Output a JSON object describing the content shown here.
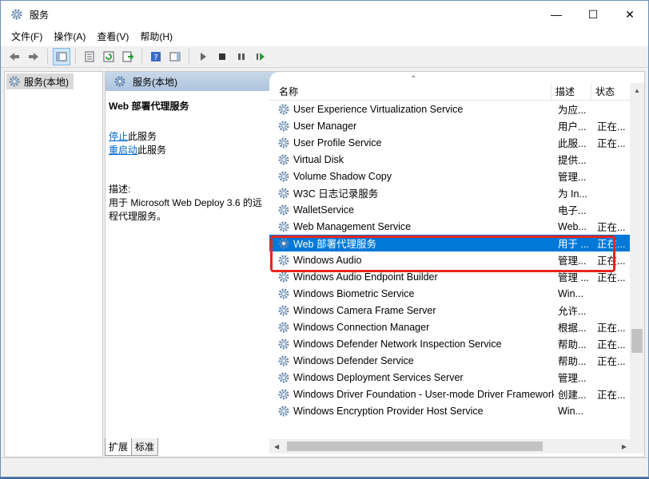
{
  "window": {
    "title": "服务"
  },
  "menu": [
    "文件(F)",
    "操作(A)",
    "查看(V)",
    "帮助(H)"
  ],
  "tree": {
    "label": "服务(本地)"
  },
  "main_header": "服务(本地)",
  "desc": {
    "title": "Web 部署代理服务",
    "stop_link": "停止",
    "stop_suffix": "此服务",
    "restart_link": "重启动",
    "restart_suffix": "此服务",
    "desc_label": "描述:",
    "desc_text": "用于 Microsoft Web Deploy 3.6 的远程代理服务。"
  },
  "columns": {
    "name": "名称",
    "description": "描述",
    "status": "状态"
  },
  "services": [
    {
      "name": "User Experience Virtualization Service",
      "desc": "为应...",
      "status": ""
    },
    {
      "name": "User Manager",
      "desc": "用户...",
      "status": "正在..."
    },
    {
      "name": "User Profile Service",
      "desc": "此服...",
      "status": "正在..."
    },
    {
      "name": "Virtual Disk",
      "desc": "提供...",
      "status": ""
    },
    {
      "name": "Volume Shadow Copy",
      "desc": "管理...",
      "status": ""
    },
    {
      "name": "W3C 日志记录服务",
      "desc": "为 In...",
      "status": ""
    },
    {
      "name": "WalletService",
      "desc": "电子...",
      "status": ""
    },
    {
      "name": "Web Management Service",
      "desc": "Web...",
      "status": "正在..."
    },
    {
      "name": "Web 部署代理服务",
      "desc": "用于 ...",
      "status": "正在..."
    },
    {
      "name": "Windows Audio",
      "desc": "管理...",
      "status": "正在..."
    },
    {
      "name": "Windows Audio Endpoint Builder",
      "desc": "管理 ...",
      "status": "正在..."
    },
    {
      "name": "Windows Biometric Service",
      "desc": "Win...",
      "status": ""
    },
    {
      "name": "Windows Camera Frame Server",
      "desc": "允许...",
      "status": ""
    },
    {
      "name": "Windows Connection Manager",
      "desc": "根据...",
      "status": "正在..."
    },
    {
      "name": "Windows Defender Network Inspection Service",
      "desc": "帮助...",
      "status": "正在..."
    },
    {
      "name": "Windows Defender Service",
      "desc": "帮助...",
      "status": "正在..."
    },
    {
      "name": "Windows Deployment Services Server",
      "desc": "管理...",
      "status": ""
    },
    {
      "name": "Windows Driver Foundation - User-mode Driver Framework",
      "desc": "创建...",
      "status": "正在..."
    },
    {
      "name": "Windows Encryption Provider Host Service",
      "desc": "Win...",
      "status": ""
    }
  ],
  "selected_index": 8,
  "tabs": [
    "扩展",
    "标准"
  ]
}
